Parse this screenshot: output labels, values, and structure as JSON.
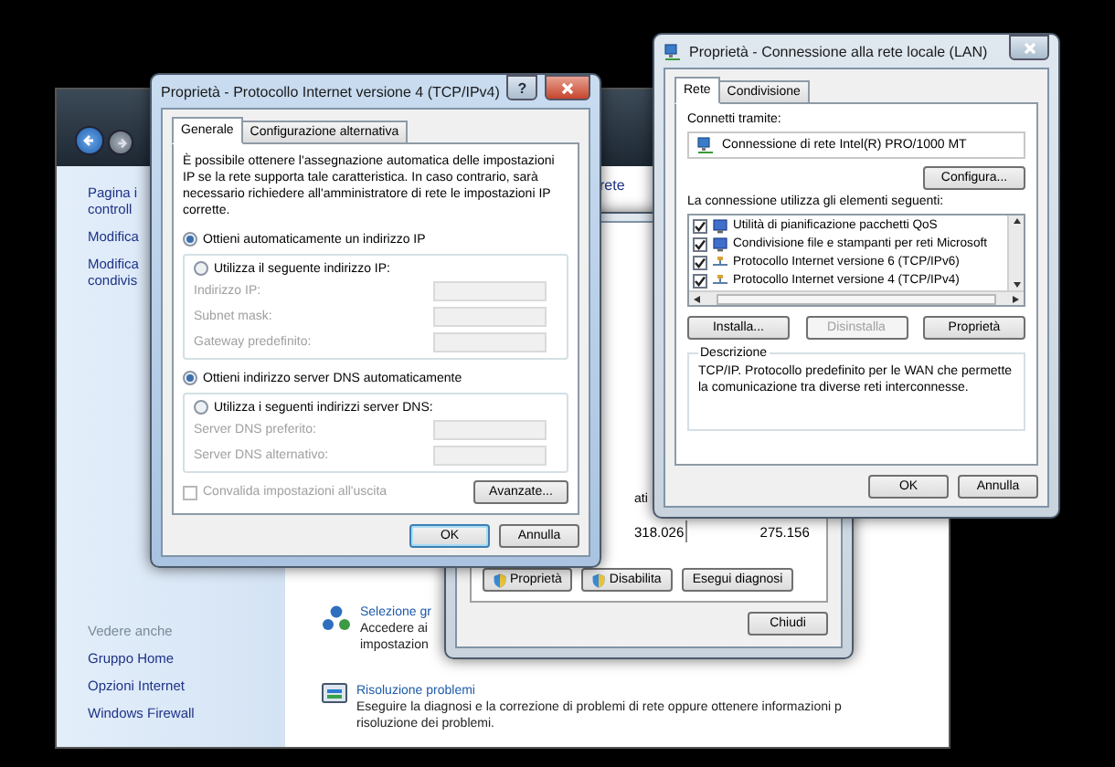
{
  "background_window": {
    "header": "rete",
    "sidebar": {
      "items": [
        {
          "lines": [
            "Pagina i",
            "controll"
          ]
        },
        {
          "lines": [
            "Modifica"
          ]
        },
        {
          "lines": [
            "Modifica",
            "condivis"
          ]
        }
      ],
      "see_also_title": "Vedere anche",
      "see_also": [
        "Gruppo Home",
        "Opzioni Internet",
        "Windows Firewall"
      ]
    },
    "tasks": [
      {
        "kind": "network",
        "title": "Selezione gr",
        "lines": [
          "Accedere ai",
          "impostazion"
        ]
      },
      {
        "kind": "troubleshoot",
        "title": "Risoluzione problemi",
        "lines": [
          "Eseguire la diagnosi e la correzione di problemi di rete oppure ottenere informazioni p",
          "risoluzione dei problemi."
        ]
      }
    ]
  },
  "status_window": {
    "activity_label": "ati",
    "sent": "318.026",
    "received": "275.156",
    "buttons": [
      {
        "label": "Proprietà",
        "shield": true
      },
      {
        "label": "Disabilita",
        "shield": true
      },
      {
        "label": "Esegui diagnosi",
        "shield": false
      }
    ],
    "close_button": "Chiudi"
  },
  "ipv4_dialog": {
    "title": "Proprietà - Protocollo Internet versione 4 (TCP/IPv4)",
    "active": true,
    "help_button": "?",
    "tabs": [
      {
        "label": "Generale",
        "selected": true
      },
      {
        "label": "Configurazione alternativa",
        "selected": false
      }
    ],
    "intro": "È possibile ottenere l'assegnazione automatica delle impostazioni IP se la rete supporta tale caratteristica. In caso contrario, sarà necessario richiedere all'amministratore di rete le impostazioni IP corrette.",
    "ip_options": [
      {
        "label": "Ottieni automaticamente un indirizzo IP",
        "selected": true
      },
      {
        "label": "Utilizza il seguente indirizzo IP:",
        "selected": false
      }
    ],
    "ip_fields": [
      {
        "label": "Indirizzo IP:",
        "disabled": true
      },
      {
        "label": "Subnet mask:",
        "disabled": true
      },
      {
        "label": "Gateway predefinito:",
        "disabled": true
      }
    ],
    "dns_options": [
      {
        "label": "Ottieni indirizzo server DNS automaticamente",
        "selected": true
      },
      {
        "label": "Utilizza i seguenti indirizzi server DNS:",
        "selected": false
      }
    ],
    "dns_fields": [
      {
        "label": "Server DNS preferito:",
        "disabled": true
      },
      {
        "label": "Server DNS alternativo:",
        "disabled": true
      }
    ],
    "validate": {
      "label": "Convalida impostazioni all'uscita",
      "checked": false,
      "disabled": true
    },
    "advanced_button": "Avanzate...",
    "buttons": [
      {
        "label": "OK",
        "default": true
      },
      {
        "label": "Annulla",
        "default": false
      }
    ]
  },
  "lan_dialog": {
    "title": "Proprietà - Connessione alla rete locale (LAN)",
    "active": false,
    "tabs": [
      {
        "label": "Rete",
        "selected": true
      },
      {
        "label": "Condivisione",
        "selected": false
      }
    ],
    "connect_label": "Connetti tramite:",
    "adapter": "Connessione di rete Intel(R) PRO/1000 MT",
    "configure_button": "Configura...",
    "items_label": "La connessione utilizza gli elementi seguenti:",
    "items": [
      {
        "kind": "service",
        "label": "Utilità di pianificazione pacchetti QoS",
        "checked": true
      },
      {
        "kind": "service",
        "label": "Condivisione file e stampanti per reti Microsoft",
        "checked": true
      },
      {
        "kind": "protocol",
        "label": "Protocollo Internet versione 6 (TCP/IPv6)",
        "checked": true
      },
      {
        "kind": "protocol",
        "label": "Protocollo Internet versione 4 (TCP/IPv4)",
        "checked": true
      }
    ],
    "item_buttons": [
      {
        "label": "Installa...",
        "disabled": false
      },
      {
        "label": "Disinstalla",
        "disabled": true
      },
      {
        "label": "Proprietà",
        "disabled": false
      }
    ],
    "description_title": "Descrizione",
    "description": "TCP/IP. Protocollo predefinito per le WAN che permette la comunicazione tra diverse reti interconnesse.",
    "buttons": [
      {
        "label": "OK",
        "default": false
      },
      {
        "label": "Annulla",
        "default": false
      }
    ]
  }
}
